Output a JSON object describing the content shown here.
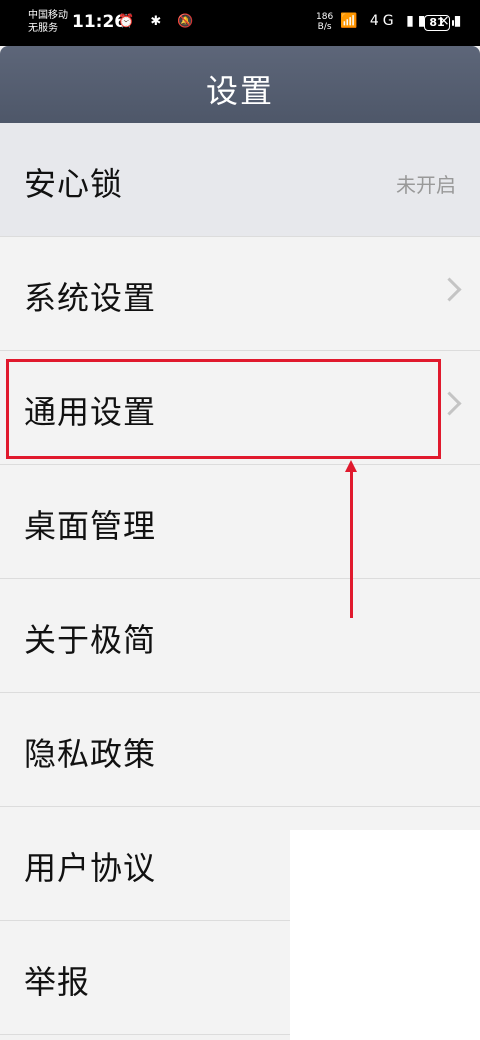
{
  "status_bar": {
    "carrier_line1": "中国移动",
    "carrier_line2": "无服务",
    "time": "11:26",
    "left_icons": "⏰ ✱ 🔕",
    "speed_value": "186",
    "speed_unit": "B/s",
    "right_icons": "📶 4G ▮▮ ×▮",
    "battery": "81"
  },
  "header": {
    "title": "设置"
  },
  "settings_list": [
    {
      "label": "安心锁",
      "value": "未开启"
    },
    {
      "label": "系统设置"
    },
    {
      "label": "通用设置"
    },
    {
      "label": "桌面管理"
    },
    {
      "label": "关于极简"
    },
    {
      "label": "隐私政策"
    },
    {
      "label": "用户协议"
    },
    {
      "label": "举报"
    }
  ],
  "colors": {
    "header_bg": "#566074",
    "highlight": "#e0192d",
    "list_bg": "#f3f3f3"
  }
}
